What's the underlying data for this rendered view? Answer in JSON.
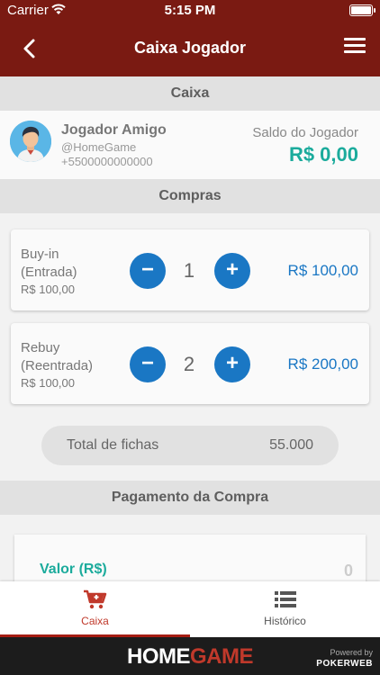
{
  "status_bar": {
    "carrier": "Carrier",
    "time": "5:15 PM"
  },
  "nav": {
    "title": "Caixa Jogador"
  },
  "sections": {
    "caixa": "Caixa",
    "compras": "Compras",
    "pagamento": "Pagamento da Compra"
  },
  "player": {
    "name": "Jogador Amigo",
    "handle": "@HomeGame",
    "phone": "+5500000000000",
    "saldo_label": "Saldo do Jogador",
    "saldo_value": "R$ 0,00"
  },
  "purchases": [
    {
      "label_line1": "Buy-in",
      "label_line2": "(Entrada)",
      "unit_price": "R$ 100,00",
      "minus": "−",
      "plus": "+",
      "quantity": "1",
      "total": "R$ 100,00"
    },
    {
      "label_line1": "Rebuy",
      "label_line2": "(Reentrada)",
      "unit_price": "R$ 100,00",
      "minus": "−",
      "plus": "+",
      "quantity": "2",
      "total": "R$ 200,00"
    }
  ],
  "chips": {
    "label": "Total de fichas",
    "value": "55.000"
  },
  "payment": {
    "label": "Valor (R$)",
    "value": "0"
  },
  "tabs": [
    {
      "label": "Caixa",
      "icon": "cart-plus-icon",
      "active": true
    },
    {
      "label": "Histórico",
      "icon": "list-icon",
      "active": false
    }
  ],
  "footer": {
    "brand_home": "HOME",
    "brand_game": "GAME",
    "powered_by": "Powered by",
    "pokerweb": "POKERWEB"
  },
  "colors": {
    "primary": "#7a1a12",
    "accent_blue": "#1a77c4",
    "accent_teal": "#1bab9c",
    "tab_active": "#c0392b"
  }
}
